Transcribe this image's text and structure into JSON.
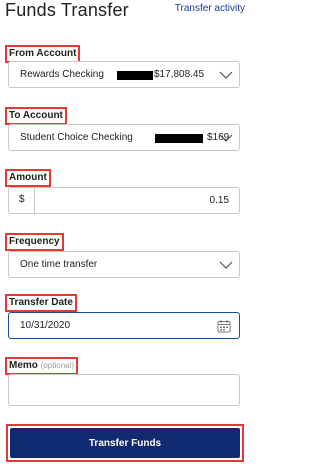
{
  "header": {
    "title": "Funds Transfer",
    "activity_link": "Transfer activity"
  },
  "from_account": {
    "label": "From Account",
    "name": "Rewards Checking",
    "balance": "$17,808.45",
    "icon": "chevron-down-icon"
  },
  "to_account": {
    "label": "To Account",
    "name": "Student Choice Checking",
    "balance": "$169",
    "icon": "chevron-down-icon"
  },
  "amount": {
    "label": "Amount",
    "currency": "$",
    "value": "0.15"
  },
  "frequency": {
    "label": "Frequency",
    "value": "One time transfer",
    "icon": "chevron-down-icon"
  },
  "transfer_date": {
    "label": "Transfer Date",
    "value": "10/31/2020",
    "icon": "calendar-icon"
  },
  "memo": {
    "label": "Memo",
    "optional": "(optional)",
    "value": ""
  },
  "submit": {
    "label": "Transfer Funds"
  },
  "colors": {
    "highlight": "#e53935",
    "primary": "#0f2a6e",
    "link": "#1a3a8f",
    "focus": "#1e4f9e"
  }
}
